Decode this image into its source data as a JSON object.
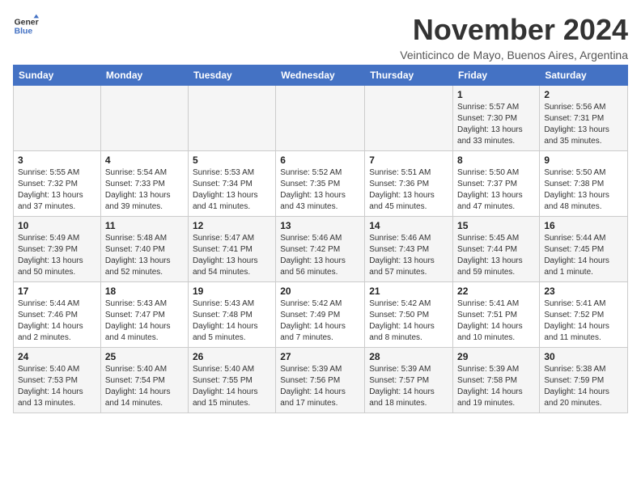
{
  "logo": {
    "text_general": "General",
    "text_blue": "Blue"
  },
  "header": {
    "month_title": "November 2024",
    "subtitle": "Veinticinco de Mayo, Buenos Aires, Argentina"
  },
  "weekdays": [
    "Sunday",
    "Monday",
    "Tuesday",
    "Wednesday",
    "Thursday",
    "Friday",
    "Saturday"
  ],
  "weeks": [
    [
      {
        "day": "",
        "sunrise": "",
        "sunset": "",
        "daylight": ""
      },
      {
        "day": "",
        "sunrise": "",
        "sunset": "",
        "daylight": ""
      },
      {
        "day": "",
        "sunrise": "",
        "sunset": "",
        "daylight": ""
      },
      {
        "day": "",
        "sunrise": "",
        "sunset": "",
        "daylight": ""
      },
      {
        "day": "",
        "sunrise": "",
        "sunset": "",
        "daylight": ""
      },
      {
        "day": "1",
        "sunrise": "Sunrise: 5:57 AM",
        "sunset": "Sunset: 7:30 PM",
        "daylight": "Daylight: 13 hours and 33 minutes."
      },
      {
        "day": "2",
        "sunrise": "Sunrise: 5:56 AM",
        "sunset": "Sunset: 7:31 PM",
        "daylight": "Daylight: 13 hours and 35 minutes."
      }
    ],
    [
      {
        "day": "3",
        "sunrise": "Sunrise: 5:55 AM",
        "sunset": "Sunset: 7:32 PM",
        "daylight": "Daylight: 13 hours and 37 minutes."
      },
      {
        "day": "4",
        "sunrise": "Sunrise: 5:54 AM",
        "sunset": "Sunset: 7:33 PM",
        "daylight": "Daylight: 13 hours and 39 minutes."
      },
      {
        "day": "5",
        "sunrise": "Sunrise: 5:53 AM",
        "sunset": "Sunset: 7:34 PM",
        "daylight": "Daylight: 13 hours and 41 minutes."
      },
      {
        "day": "6",
        "sunrise": "Sunrise: 5:52 AM",
        "sunset": "Sunset: 7:35 PM",
        "daylight": "Daylight: 13 hours and 43 minutes."
      },
      {
        "day": "7",
        "sunrise": "Sunrise: 5:51 AM",
        "sunset": "Sunset: 7:36 PM",
        "daylight": "Daylight: 13 hours and 45 minutes."
      },
      {
        "day": "8",
        "sunrise": "Sunrise: 5:50 AM",
        "sunset": "Sunset: 7:37 PM",
        "daylight": "Daylight: 13 hours and 47 minutes."
      },
      {
        "day": "9",
        "sunrise": "Sunrise: 5:50 AM",
        "sunset": "Sunset: 7:38 PM",
        "daylight": "Daylight: 13 hours and 48 minutes."
      }
    ],
    [
      {
        "day": "10",
        "sunrise": "Sunrise: 5:49 AM",
        "sunset": "Sunset: 7:39 PM",
        "daylight": "Daylight: 13 hours and 50 minutes."
      },
      {
        "day": "11",
        "sunrise": "Sunrise: 5:48 AM",
        "sunset": "Sunset: 7:40 PM",
        "daylight": "Daylight: 13 hours and 52 minutes."
      },
      {
        "day": "12",
        "sunrise": "Sunrise: 5:47 AM",
        "sunset": "Sunset: 7:41 PM",
        "daylight": "Daylight: 13 hours and 54 minutes."
      },
      {
        "day": "13",
        "sunrise": "Sunrise: 5:46 AM",
        "sunset": "Sunset: 7:42 PM",
        "daylight": "Daylight: 13 hours and 56 minutes."
      },
      {
        "day": "14",
        "sunrise": "Sunrise: 5:46 AM",
        "sunset": "Sunset: 7:43 PM",
        "daylight": "Daylight: 13 hours and 57 minutes."
      },
      {
        "day": "15",
        "sunrise": "Sunrise: 5:45 AM",
        "sunset": "Sunset: 7:44 PM",
        "daylight": "Daylight: 13 hours and 59 minutes."
      },
      {
        "day": "16",
        "sunrise": "Sunrise: 5:44 AM",
        "sunset": "Sunset: 7:45 PM",
        "daylight": "Daylight: 14 hours and 1 minute."
      }
    ],
    [
      {
        "day": "17",
        "sunrise": "Sunrise: 5:44 AM",
        "sunset": "Sunset: 7:46 PM",
        "daylight": "Daylight: 14 hours and 2 minutes."
      },
      {
        "day": "18",
        "sunrise": "Sunrise: 5:43 AM",
        "sunset": "Sunset: 7:47 PM",
        "daylight": "Daylight: 14 hours and 4 minutes."
      },
      {
        "day": "19",
        "sunrise": "Sunrise: 5:43 AM",
        "sunset": "Sunset: 7:48 PM",
        "daylight": "Daylight: 14 hours and 5 minutes."
      },
      {
        "day": "20",
        "sunrise": "Sunrise: 5:42 AM",
        "sunset": "Sunset: 7:49 PM",
        "daylight": "Daylight: 14 hours and 7 minutes."
      },
      {
        "day": "21",
        "sunrise": "Sunrise: 5:42 AM",
        "sunset": "Sunset: 7:50 PM",
        "daylight": "Daylight: 14 hours and 8 minutes."
      },
      {
        "day": "22",
        "sunrise": "Sunrise: 5:41 AM",
        "sunset": "Sunset: 7:51 PM",
        "daylight": "Daylight: 14 hours and 10 minutes."
      },
      {
        "day": "23",
        "sunrise": "Sunrise: 5:41 AM",
        "sunset": "Sunset: 7:52 PM",
        "daylight": "Daylight: 14 hours and 11 minutes."
      }
    ],
    [
      {
        "day": "24",
        "sunrise": "Sunrise: 5:40 AM",
        "sunset": "Sunset: 7:53 PM",
        "daylight": "Daylight: 14 hours and 13 minutes."
      },
      {
        "day": "25",
        "sunrise": "Sunrise: 5:40 AM",
        "sunset": "Sunset: 7:54 PM",
        "daylight": "Daylight: 14 hours and 14 minutes."
      },
      {
        "day": "26",
        "sunrise": "Sunrise: 5:40 AM",
        "sunset": "Sunset: 7:55 PM",
        "daylight": "Daylight: 14 hours and 15 minutes."
      },
      {
        "day": "27",
        "sunrise": "Sunrise: 5:39 AM",
        "sunset": "Sunset: 7:56 PM",
        "daylight": "Daylight: 14 hours and 17 minutes."
      },
      {
        "day": "28",
        "sunrise": "Sunrise: 5:39 AM",
        "sunset": "Sunset: 7:57 PM",
        "daylight": "Daylight: 14 hours and 18 minutes."
      },
      {
        "day": "29",
        "sunrise": "Sunrise: 5:39 AM",
        "sunset": "Sunset: 7:58 PM",
        "daylight": "Daylight: 14 hours and 19 minutes."
      },
      {
        "day": "30",
        "sunrise": "Sunrise: 5:38 AM",
        "sunset": "Sunset: 7:59 PM",
        "daylight": "Daylight: 14 hours and 20 minutes."
      }
    ]
  ]
}
